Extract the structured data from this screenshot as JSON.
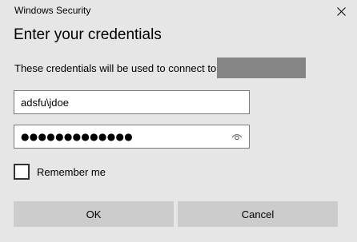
{
  "window": {
    "title": "Windows Security"
  },
  "dialog": {
    "heading": "Enter your credentials",
    "message": "These credentials will be used to connect to"
  },
  "fields": {
    "username": {
      "value": "adsfu\\jdoe"
    },
    "password": {
      "masked_value": "●●●●●●●●●●●●●"
    }
  },
  "remember": {
    "label": "Remember me",
    "checked": false
  },
  "buttons": {
    "ok": "OK",
    "cancel": "Cancel"
  },
  "icons": {
    "close": "close-icon",
    "reveal": "eye-icon"
  },
  "colors": {
    "background": "#e6e6e6",
    "button": "#cccccc",
    "redaction": "#858585"
  }
}
